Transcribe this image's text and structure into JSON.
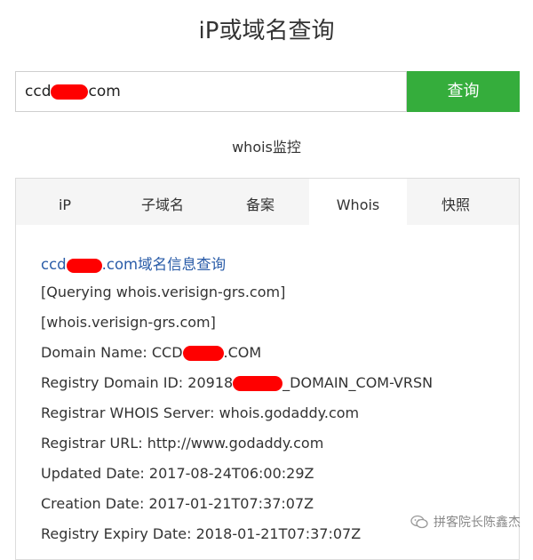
{
  "page": {
    "title": "iP或域名查询"
  },
  "search": {
    "value_prefix": "ccd",
    "value_suffix": "com",
    "button_label": "查询"
  },
  "monitor_link": "whois监控",
  "tabs": [
    {
      "label": "iP",
      "active": false
    },
    {
      "label": "子域名",
      "active": false
    },
    {
      "label": "备案",
      "active": false
    },
    {
      "label": "Whois",
      "active": true
    },
    {
      "label": "快照",
      "active": false
    }
  ],
  "result": {
    "heading_prefix": "ccd",
    "heading_suffix": ".com域名信息查询",
    "lines": [
      {
        "text": "[Querying whois.verisign-grs.com]"
      },
      {
        "text": "[whois.verisign-grs.com]"
      },
      {
        "pre": "Domain Name: CCD",
        "post": ".COM"
      },
      {
        "pre": "Registry Domain ID: 20918",
        "post": "_DOMAIN_COM-VRSN"
      },
      {
        "text": "Registrar WHOIS Server: whois.godaddy.com"
      },
      {
        "text": "Registrar URL: http://www.godaddy.com"
      },
      {
        "text": "Updated Date: 2017-08-24T06:00:29Z"
      },
      {
        "text": "Creation Date: 2017-01-21T07:37:07Z"
      },
      {
        "text": "Registry Expiry Date: 2018-01-21T07:37:07Z"
      }
    ]
  },
  "watermark": {
    "text": "拼客院长陈鑫杰",
    "icon": "wechat-icon"
  },
  "colors": {
    "accent_green": "#35ad3c",
    "link_blue": "#2a5ca8",
    "redaction": "#ff0000"
  }
}
